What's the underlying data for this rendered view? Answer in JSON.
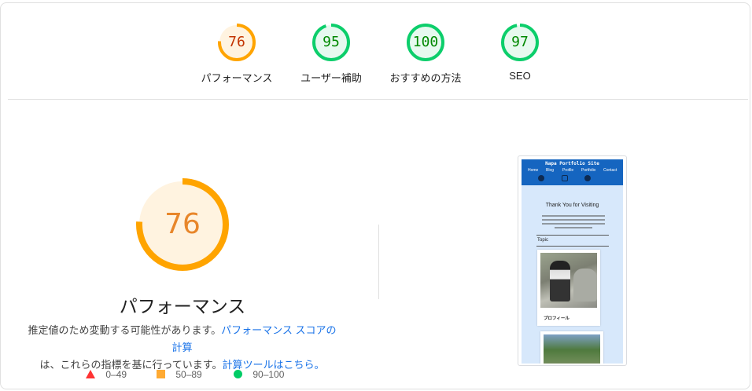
{
  "summary_gauges": [
    {
      "label": "パフォーマンス",
      "score": "76",
      "fraction": 0.76,
      "color": "#ffa400",
      "text_color": "#c33300",
      "fill": "#fff3e0"
    },
    {
      "label": "ユーザー補助",
      "score": "95",
      "fraction": 0.95,
      "color": "#0cce6b",
      "text_color": "#008800",
      "fill": "#e6f9ef"
    },
    {
      "label": "おすすめの方法",
      "score": "100",
      "fraction": 1.0,
      "color": "#0cce6b",
      "text_color": "#008800",
      "fill": "#e6f9ef"
    },
    {
      "label": "SEO",
      "score": "97",
      "fraction": 0.97,
      "color": "#0cce6b",
      "text_color": "#008800",
      "fill": "#e6f9ef"
    }
  ],
  "performance": {
    "score": "76",
    "fraction": 0.76,
    "title": "パフォーマンス",
    "description_text": "推定値のため変動する可能性があります。",
    "description_link1": "パフォーマンス スコアの計算",
    "description_text2": "は、これらの指標を基に行っています。",
    "description_link2": "計算ツールはこちら。"
  },
  "legend": [
    {
      "shape": "triangle",
      "range": "0–49",
      "color": "#ff3333"
    },
    {
      "shape": "square",
      "range": "50–89",
      "color": "#ffaa33"
    },
    {
      "shape": "circle",
      "range": "90–100",
      "color": "#00cc66"
    }
  ],
  "screenshot": {
    "site_title": "Napa Portfolio Site",
    "nav": [
      "Home",
      "Blog",
      "Profile",
      "Portfolio",
      "Contact"
    ],
    "heading": "Thank You for Visiting",
    "section": "Topic",
    "card_caption": "プロフィール"
  }
}
